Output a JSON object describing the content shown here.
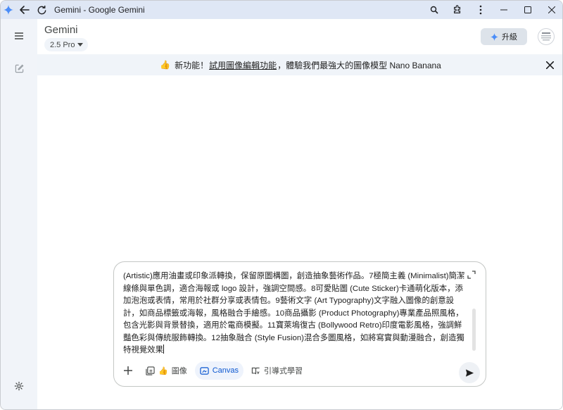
{
  "window": {
    "title": "Gemini - Google Gemini"
  },
  "header": {
    "app_name": "Gemini",
    "model": "2.5 Pro",
    "upgrade_label": "升級"
  },
  "banner": {
    "emoji": "👍",
    "prefix": "新功能！",
    "link_text": "試用圖像編輯功能",
    "suffix": "，體驗我們最強大的圖像模型 Nano Banana"
  },
  "composer": {
    "text": "(Artistic)應用油畫或印象派轉換，保留原圖構圖，創造抽象藝術作品。7極簡主義 (Minimalist)簡潔線條與單色調，適合海報或 logo 設計，強調空間感。8可愛貼圖 (Cute Sticker)卡通萌化版本，添加泡泡或表情，常用於社群分享或表情包。9藝術文字 (Art Typography)文字融入圖像的創意設計，如商品標籤或海報，風格融合手繪感。10商品攝影 (Product Photography)專業產品照風格，包含光影與背景替換，適用於電商模擬。11寶萊塢復古 (Bollywood Retro)印度電影風格，強調鮮豔色彩與傳統服飾轉換。12抽象融合 (Style Fusion)混合多圖風格，如將寫實與動漫融合，創造獨特視覺效果",
    "tools": {
      "image_label": "圖像",
      "canvas_label": "Canvas",
      "guided_label": "引導式學習"
    }
  },
  "colors": {
    "titlebar": "#dfe7f5",
    "sidebar": "#f1f4f9",
    "banner": "#f0f4f9",
    "accent": "#0b57d0",
    "gemini_star": "#4b8df8"
  }
}
